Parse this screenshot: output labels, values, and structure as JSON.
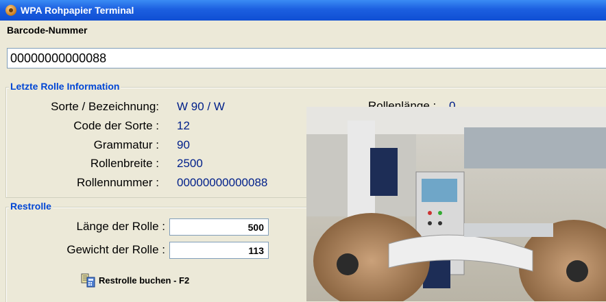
{
  "window": {
    "title": "WPA Rohpapier Terminal",
    "icon": "app-icon"
  },
  "barcode": {
    "label": "Barcode-Nummer",
    "value": "00000000000088"
  },
  "info": {
    "title": "Letzte Rolle Information",
    "rows": [
      {
        "label": "Sorte / Bezeichnung:",
        "value": "W 90 / W"
      },
      {
        "label": "Code der Sorte :",
        "value": "12"
      },
      {
        "label": "Grammatur :",
        "value": "90"
      },
      {
        "label": "Rollenbreite :",
        "value": "2500"
      },
      {
        "label": "Rollennummer :",
        "value": "00000000000088"
      }
    ],
    "partial_label": "Rollenlänge :",
    "partial_value": "0"
  },
  "restrolle": {
    "title": "Restrolle",
    "length_label": "Länge der Rolle :",
    "length_value": "500",
    "weight_label": "Gewicht der Rolle :",
    "weight_value": "113",
    "book_button": "Restrolle buchen - F2",
    "book_icon": "booking-icon"
  },
  "colors": {
    "title_bar": "#1c5fe0",
    "group_title": "#0046d5",
    "value_text": "#00208a",
    "background": "#ece9d8"
  }
}
